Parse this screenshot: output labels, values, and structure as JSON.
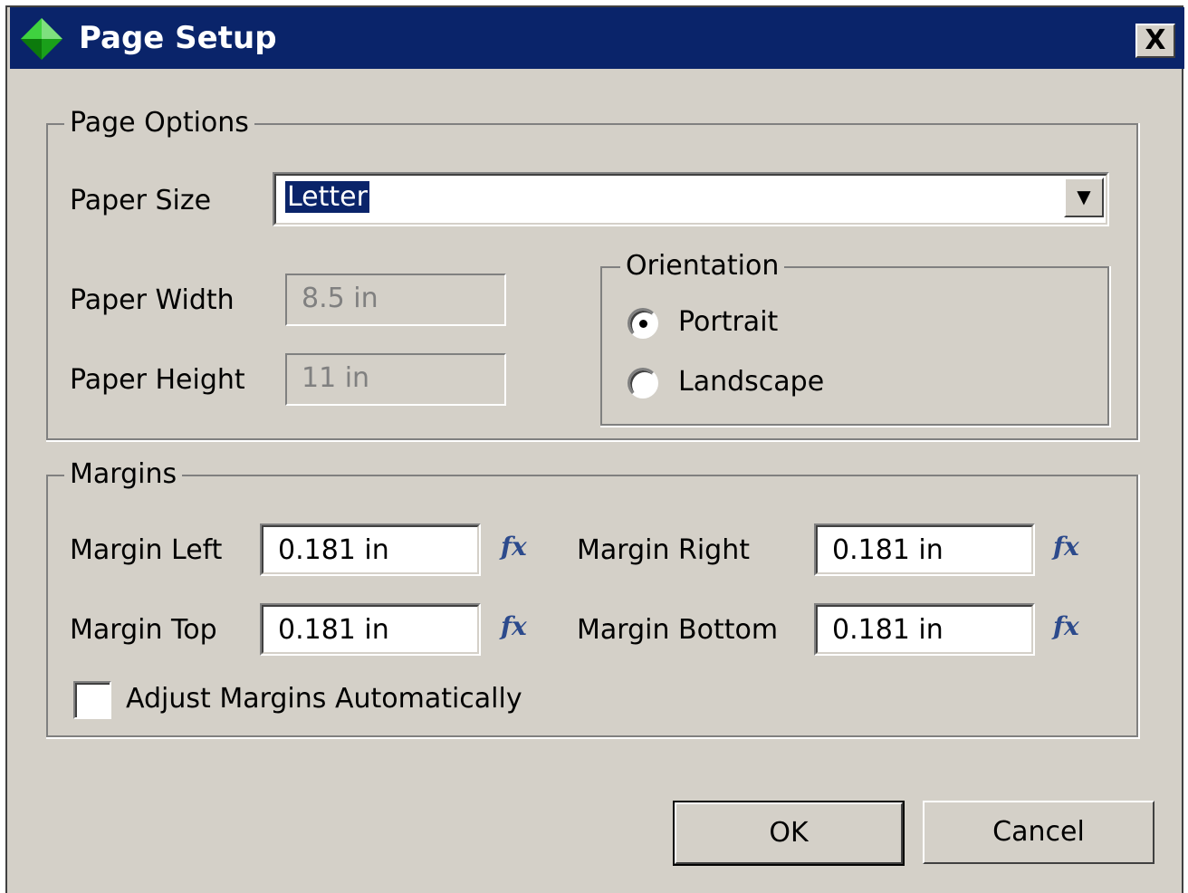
{
  "window": {
    "title": "Page Setup",
    "close_label": "X",
    "icon": "green-diamond-icon"
  },
  "page_options": {
    "legend": "Page Options",
    "paper_size": {
      "label": "Paper Size",
      "value": "Letter",
      "dropdown_glyph": "▼"
    },
    "paper_width": {
      "label": "Paper Width",
      "value": "8.5 in"
    },
    "paper_height": {
      "label": "Paper Height",
      "value": "11 in"
    },
    "orientation": {
      "legend": "Orientation",
      "options": [
        {
          "label": "Portrait",
          "selected": true
        },
        {
          "label": "Landscape",
          "selected": false
        }
      ]
    }
  },
  "margins": {
    "legend": "Margins",
    "left": {
      "label": "Margin Left",
      "value": "0.181 in"
    },
    "right": {
      "label": "Margin Right",
      "value": "0.181 in"
    },
    "top": {
      "label": "Margin Top",
      "value": "0.181 in"
    },
    "bottom": {
      "label": "Margin Bottom",
      "value": "0.181 in"
    },
    "fx_glyph": "fx",
    "adjust_auto": {
      "label": "Adjust Margins Automatically",
      "checked": false
    }
  },
  "buttons": {
    "ok": "OK",
    "cancel": "Cancel"
  },
  "colors": {
    "titlebar": "#0a246a",
    "dialog_bg": "#d4d0c8",
    "selection": "#0a246a",
    "fx_color": "#2c4a8c",
    "icon_green": "#22c522"
  }
}
